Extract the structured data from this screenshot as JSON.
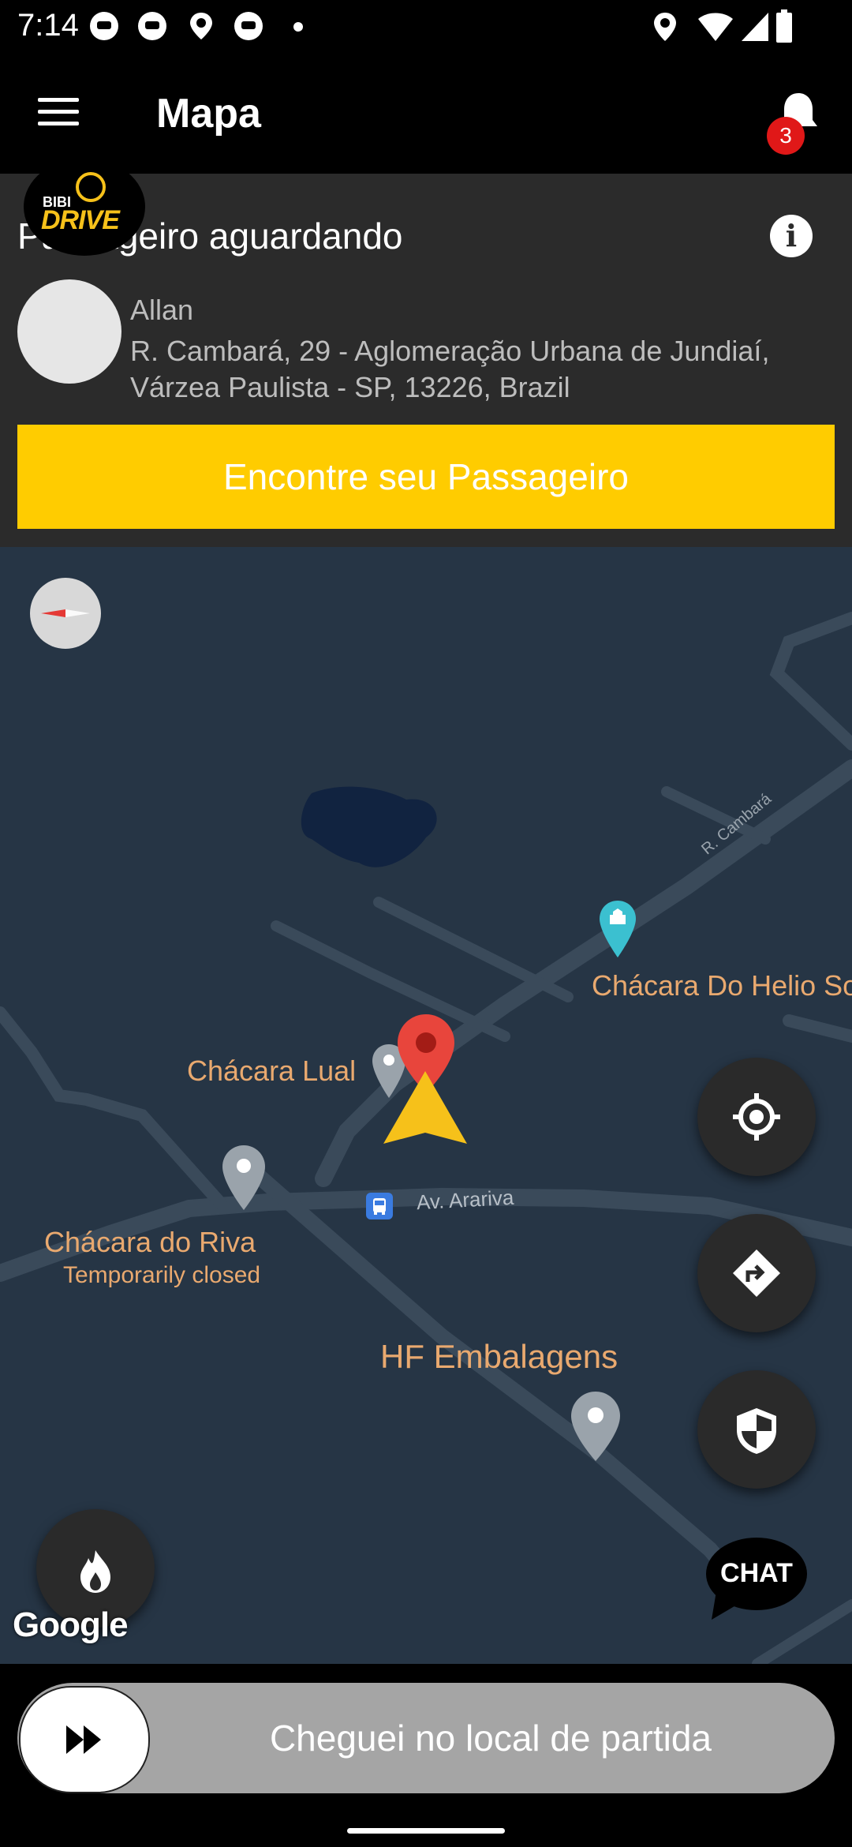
{
  "status_bar": {
    "time": "7:14"
  },
  "app_bar": {
    "title": "Mapa",
    "notification_count": "3"
  },
  "passenger_card": {
    "logo_top": "BIBI",
    "logo_bottom": "DRIVE",
    "title": "Passageiro aguardando",
    "passenger_name": "Allan",
    "address": "R. Cambará, 29 - Aglomeração Urbana de Jundiaí, Várzea Paulista - SP, 13226, Brazil",
    "find_button": "Encontre seu Passageiro"
  },
  "map": {
    "street_labels": {
      "r_cambara": "R. Cambará",
      "av_arariva": "Av. Arariva"
    },
    "places": {
      "chacara_helio": "Chácara Do Helio Sou",
      "chacara_lual": "Chácara Lual",
      "chacara_riva": "Chácara do Riva",
      "chacara_riva_status": "Temporarily closed",
      "hf_embalagens": "HF Embalagens"
    },
    "attribution": "Google",
    "chat_label": "CHAT"
  },
  "slider": {
    "label": "Cheguei no local de partida"
  },
  "colors": {
    "accent": "#ffcc00",
    "map_bg": "#263545",
    "badge": "#e01818",
    "label": "#e9a96f"
  }
}
